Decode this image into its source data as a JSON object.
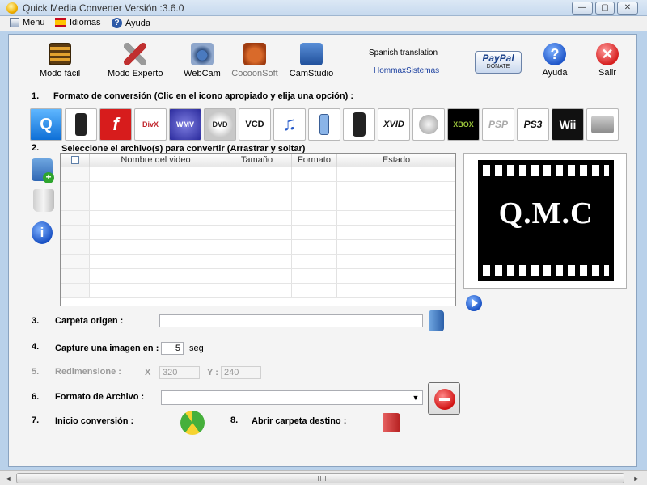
{
  "window": {
    "title": "Quick Media Converter   Versión :3.6.0",
    "minimize": "—",
    "maximize": "▢",
    "close": "✕"
  },
  "menu": {
    "items": [
      {
        "label": "Menu",
        "icon": "document-icon"
      },
      {
        "label": "Idiomas",
        "icon": "spain-flag-icon"
      },
      {
        "label": "Ayuda",
        "icon": "help-icon"
      }
    ]
  },
  "toolbar": {
    "modo_facil": "Modo fácil",
    "modo_experto": "Modo Experto",
    "webcam": "WebCam",
    "cocoonsoft": "CocoonSoft",
    "camstudio": "CamStudio",
    "spanish_translation": "Spanish translation",
    "translator": "HommaxSistemas",
    "paypal": "PayPal",
    "donate": "DONATE",
    "ayuda": "Ayuda",
    "salir": "Salir"
  },
  "section1": {
    "num": "1.",
    "text": "Formato de conversión (Clic en el icono apropiado y elija una opción) :",
    "formats": [
      {
        "name": "quicktime",
        "label": "Q"
      },
      {
        "name": "ipod",
        "label": ""
      },
      {
        "name": "flash",
        "label": "f"
      },
      {
        "name": "divx",
        "label": "DivX"
      },
      {
        "name": "wmv",
        "label": "WMV"
      },
      {
        "name": "dvd",
        "label": "DVD"
      },
      {
        "name": "vcd",
        "label": "VCD"
      },
      {
        "name": "music",
        "label": "♫"
      },
      {
        "name": "mobile",
        "label": ""
      },
      {
        "name": "iphone",
        "label": ""
      },
      {
        "name": "xvid",
        "label": "XVID"
      },
      {
        "name": "satellite",
        "label": ""
      },
      {
        "name": "xbox",
        "label": "XBOX"
      },
      {
        "name": "psp",
        "label": "PSP"
      },
      {
        "name": "ps3",
        "label": "PS3"
      },
      {
        "name": "wii",
        "label": "Wii"
      },
      {
        "name": "ds",
        "label": ""
      }
    ]
  },
  "section2": {
    "num": "2.",
    "text": "Seleccione el archivo(s) para convertir (Arrastrar y soltar)",
    "columns": [
      "",
      "Nombre del video",
      "Tamaño",
      "Formato",
      "Estado"
    ],
    "rows": 9
  },
  "preview": {
    "logo_text": "Q.M.C"
  },
  "section3": {
    "num": "3.",
    "label": "Carpeta origen :",
    "value": ""
  },
  "section4": {
    "num": "4.",
    "label": "Capture una imagen en :",
    "value": "5",
    "unit": "seg"
  },
  "section5": {
    "num": "5.",
    "label": "Redimensione :",
    "x_label": "X",
    "x_value": "320",
    "y_label": "Y :",
    "y_value": "240"
  },
  "section6": {
    "num": "6.",
    "label": "Formato de Archivo :",
    "value": ""
  },
  "section7": {
    "num": "7.",
    "label": "Inicio conversión :"
  },
  "section8": {
    "num": "8.",
    "label": "Abrir carpeta destino :"
  },
  "colors": {
    "accent": "#1f56c9",
    "frame": "#b9d1ea"
  }
}
